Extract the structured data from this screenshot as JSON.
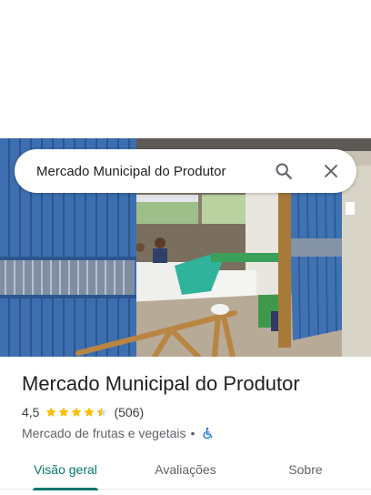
{
  "search": {
    "query": "Mercado Municipal do Produtor",
    "search_icon": "search-icon",
    "close_icon": "close-icon"
  },
  "place": {
    "title": "Mercado Municipal do Produtor",
    "rating": "4,5",
    "rating_stars": 4.5,
    "review_count": "(506)",
    "category": "Mercado de frutas e vegetais",
    "separator": "•",
    "accessibility_icon": "wheelchair-icon"
  },
  "tabs": [
    {
      "label": "Visão geral",
      "active": true
    },
    {
      "label": "Avaliações",
      "active": false
    },
    {
      "label": "Sobre",
      "active": false
    }
  ],
  "colors": {
    "accent": "#00796b",
    "star": "#fbbc04",
    "accessibility": "#1a73e8"
  }
}
